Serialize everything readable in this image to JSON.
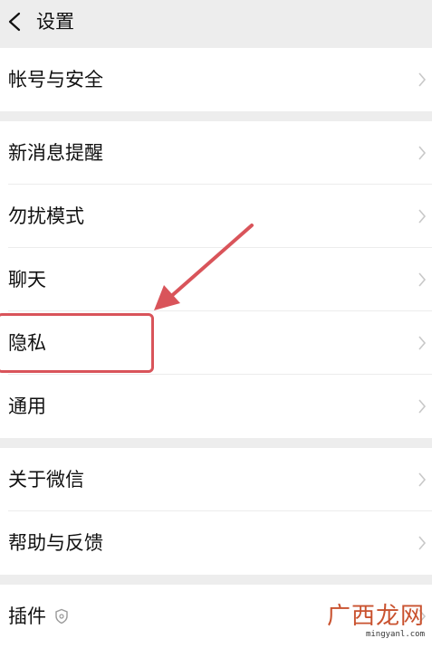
{
  "header": {
    "title": "设置"
  },
  "groups": [
    {
      "items": [
        {
          "label": "帐号与安全"
        }
      ]
    },
    {
      "items": [
        {
          "label": "新消息提醒"
        },
        {
          "label": "勿扰模式"
        },
        {
          "label": "聊天"
        },
        {
          "label": "隐私"
        },
        {
          "label": "通用"
        }
      ]
    },
    {
      "items": [
        {
          "label": "关于微信"
        },
        {
          "label": "帮助与反馈"
        }
      ]
    },
    {
      "items": [
        {
          "label": "插件"
        }
      ]
    }
  ],
  "annotation": {
    "highlighted_item": "隐私",
    "color": "#d9545a"
  },
  "watermark": {
    "title": "广西龙网",
    "url": "mingyanl.com"
  },
  "colors": {
    "background": "#ededed",
    "row_background": "#ffffff",
    "text": "#111111",
    "chevron": "#c8c8c8"
  }
}
